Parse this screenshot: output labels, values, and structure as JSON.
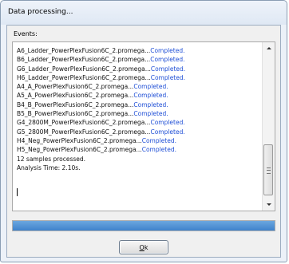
{
  "window": {
    "title": "Data processing..."
  },
  "events": {
    "label": "Events:",
    "lines": [
      {
        "name": "A6_Ladder_PowerPlexFusion6C_2.promega...",
        "status": "Completed."
      },
      {
        "name": "B6_Ladder_PowerPlexFusion6C_2.promega...",
        "status": "Completed."
      },
      {
        "name": "G6_Ladder_PowerPlexFusion6C_2.promega...",
        "status": "Completed."
      },
      {
        "name": "H6_Ladder_PowerPlexFusion6C_2.promega...",
        "status": "Completed."
      },
      {
        "name": "A4_A_PowerPlexFusion6C_2.promega...",
        "status": "Completed."
      },
      {
        "name": "A5_A_PowerPlexFusion6C_2.promega...",
        "status": "Completed."
      },
      {
        "name": "B4_B_PowerPlexFusion6C_2.promega...",
        "status": "Completed."
      },
      {
        "name": "B5_B_PowerPlexFusion6C_2.promega...",
        "status": "Completed."
      },
      {
        "name": "G4_2800M_PowerPlexFusion6C_2.promega...",
        "status": "Completed."
      },
      {
        "name": "G5_2800M_PowerPlexFusion6C_2.promega...",
        "status": "Completed."
      },
      {
        "name": "H4_Neg_PowerPlexFusion6C_2.promega...",
        "status": "Completed."
      },
      {
        "name": "H5_Neg_PowerPlexFusion6C_2.promega...",
        "status": "Completed."
      }
    ],
    "summary": "12 samples processed.",
    "analysis_time": "Analysis Time: 2.10s."
  },
  "progress": {
    "value_percent": 100,
    "color": "#4a8fd6"
  },
  "buttons": {
    "ok_accel": "O",
    "ok_rest": "k"
  },
  "colors": {
    "status_text": "#1f4fd6"
  }
}
